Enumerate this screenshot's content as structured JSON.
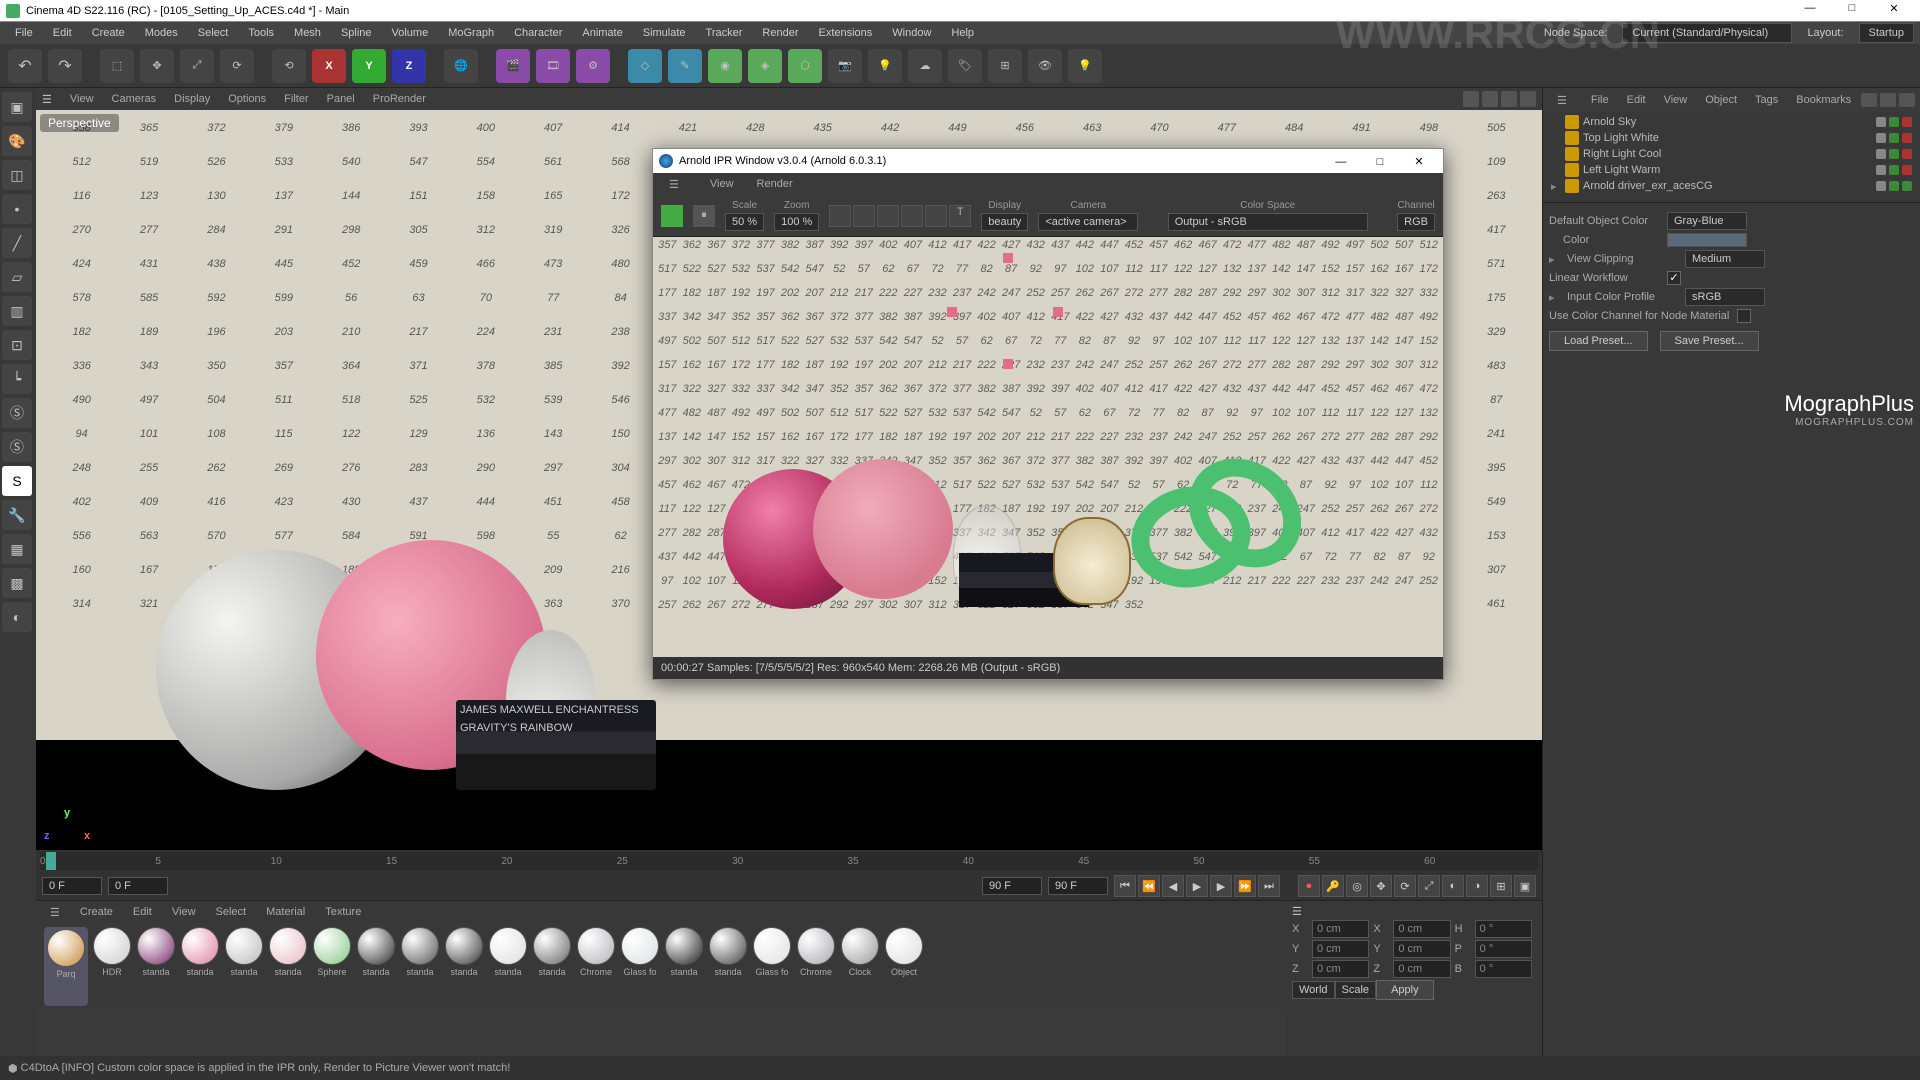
{
  "titlebar": {
    "title": "Cinema 4D S22.116 (RC) - [0105_Setting_Up_ACES.c4d *] - Main",
    "min": "—",
    "max": "□",
    "close": "✕"
  },
  "menu": {
    "items": [
      "File",
      "Edit",
      "Create",
      "Modes",
      "Select",
      "Tools",
      "Mesh",
      "Spline",
      "Volume",
      "MoGraph",
      "Character",
      "Animate",
      "Simulate",
      "Tracker",
      "Render",
      "Extensions",
      "Window",
      "Help"
    ],
    "node_space_label": "Node Space:",
    "node_space_value": "Current (Standard/Physical)",
    "layout_label": "Layout:",
    "layout_value": "Startup"
  },
  "viewport_menu": {
    "items": [
      "View",
      "Cameras",
      "Display",
      "Options",
      "Filter",
      "Panel",
      "ProRender"
    ],
    "persp": "Perspective"
  },
  "objects_panel": {
    "menu": [
      "File",
      "Edit",
      "View",
      "Object",
      "Tags",
      "Bookmarks"
    ],
    "rows": [
      {
        "name": "Arnold Sky"
      },
      {
        "name": "Top Light White"
      },
      {
        "name": "Right Light Cool"
      },
      {
        "name": "Left Light Warm"
      },
      {
        "name": "Arnold driver_exr_acesCG"
      }
    ]
  },
  "timeline": {
    "ticks": [
      "0",
      "5",
      "10",
      "15",
      "20",
      "25",
      "30",
      "35",
      "40",
      "45",
      "50",
      "55",
      "60"
    ],
    "start": "0 F",
    "cursor": "0 F",
    "end_view": "90 F",
    "end": "90 F"
  },
  "materials": {
    "menu": [
      "Create",
      "Edit",
      "View",
      "Select",
      "Material",
      "Texture"
    ],
    "items": [
      {
        "label": "Parq",
        "col": "#c88a3a"
      },
      {
        "label": "HDR",
        "col": "#cccccc"
      },
      {
        "label": "standa",
        "col": "#7a2a6a"
      },
      {
        "label": "standa",
        "col": "#e080a0"
      },
      {
        "label": "standa",
        "col": "#bbb"
      },
      {
        "label": "standa",
        "col": "#e8b8c4"
      },
      {
        "label": "Sphere",
        "col": "#88c888"
      },
      {
        "label": "standa",
        "col": "#333"
      },
      {
        "label": "standa",
        "col": "#555"
      },
      {
        "label": "standa",
        "col": "#3a3a3a"
      },
      {
        "label": "standa",
        "col": "#ddd"
      },
      {
        "label": "standa",
        "col": "#666"
      },
      {
        "label": "Chrome",
        "col": "#b0b0b8"
      },
      {
        "label": "Glass fo",
        "col": "#d8e0e0"
      },
      {
        "label": "standa",
        "col": "#222"
      },
      {
        "label": "standa",
        "col": "#444"
      },
      {
        "label": "Glass fo",
        "col": "#e0e0e0"
      },
      {
        "label": "Chrome",
        "col": "#a8a8b0"
      },
      {
        "label": "Clock",
        "col": "#999"
      },
      {
        "label": "Object",
        "col": "#ddd"
      }
    ]
  },
  "status": {
    "text": "C4DtoA    [INFO] Custom color space is applied in the IPR only, Render to Picture Viewer won't match!"
  },
  "ipr": {
    "title": "Arnold IPR Window v3.0.4 (Arnold 6.0.3.1)",
    "menu": [
      "View",
      "Render"
    ],
    "scale_label": "Scale",
    "scale_value": "50 %",
    "zoom_label": "Zoom",
    "zoom_value": "100 %",
    "display_label": "Display",
    "display_value": "beauty",
    "camera_label": "Camera",
    "camera_value": "<active camera>",
    "color_space_label": "Color Space",
    "color_space_value": "Output - sRGB",
    "channel_label": "Channel",
    "channel_value": "RGB",
    "status": "00:00:27   Samples: [7/5/5/5/5/2]   Res: 960x540   Mem: 2268.26 MB   (Output - sRGB)",
    "min": "—",
    "max": "□",
    "close": "✕"
  },
  "attrs": {
    "default_obj_color_label": "Default Object Color",
    "default_obj_color_value": "Gray-Blue",
    "color_label": "Color",
    "view_clip_label": "View Clipping",
    "view_clip_value": "Medium",
    "linear_wf_label": "Linear Workflow",
    "input_profile_label": "Input Color Profile",
    "input_profile_value": "sRGB",
    "use_color_channel_label": "Use Color Channel for Node Material",
    "load_preset": "Load Preset...",
    "save_preset": "Save Preset..."
  },
  "coords": {
    "x_label": "X",
    "x_val": "0 cm",
    "y_label": "Y",
    "y_val": "0 cm",
    "z_label": "Z",
    "z_val": "0 cm",
    "sx": "0 cm",
    "sy": "0 cm",
    "sz": "0 cm",
    "h_label": "H",
    "h_val": "0 °",
    "p_label": "P",
    "p_val": "0 °",
    "b_label": "B",
    "b_val": "0 °",
    "world": "World",
    "scale": "Scale",
    "apply": "Apply"
  },
  "books": {
    "title1": "JAMES MAXWELL",
    "title2": "ENCHANTRESS",
    "title3": "GRAVITY'S RAINBOW"
  },
  "logo": {
    "main": "MographPlus",
    "sub": "MOGRAPHPLUS.COM"
  },
  "watermark": "WWW.RRCG.CN",
  "axis": {
    "x": "x",
    "y": "y",
    "z": "z"
  }
}
